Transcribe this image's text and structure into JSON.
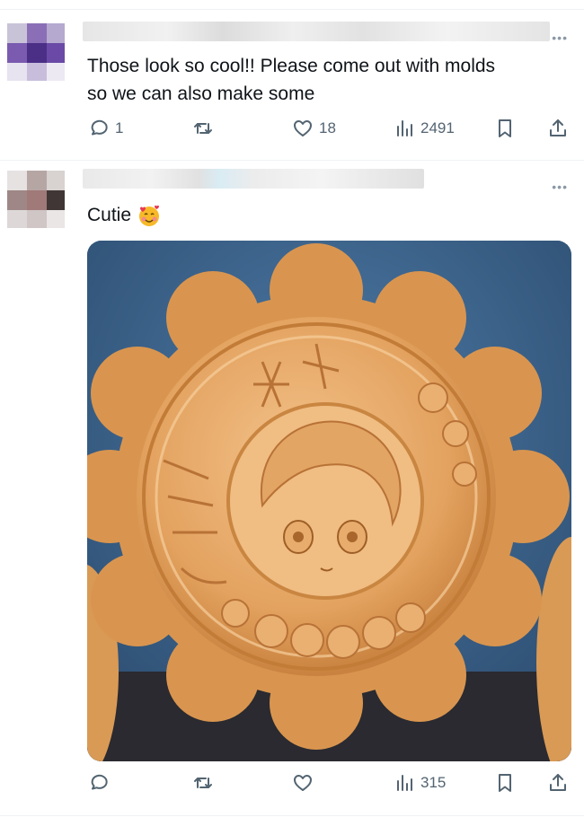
{
  "tweets": [
    {
      "text": "Those look so cool!! Please come out with molds so we can also make some",
      "text_lines": [
        "Those look so cool!! Please come out with molds",
        "so we can also make some"
      ],
      "more": "•••",
      "stats": {
        "replies": "1",
        "reposts": "",
        "likes": "18",
        "views": "2491"
      }
    },
    {
      "text": "Cutie",
      "emoji": "smiling-face-with-hearts",
      "more": "•••",
      "media": {
        "kind": "photo",
        "subject": "mooncake with character face"
      },
      "stats": {
        "replies": "",
        "reposts": "",
        "likes": "",
        "views": "315"
      }
    }
  ],
  "icons": [
    "reply-icon",
    "repost-icon",
    "like-icon",
    "views-icon",
    "bookmark-icon",
    "share-icon"
  ],
  "colors": {
    "icon": "#536471",
    "divider": "#eff3f4",
    "text": "#0f1419"
  }
}
